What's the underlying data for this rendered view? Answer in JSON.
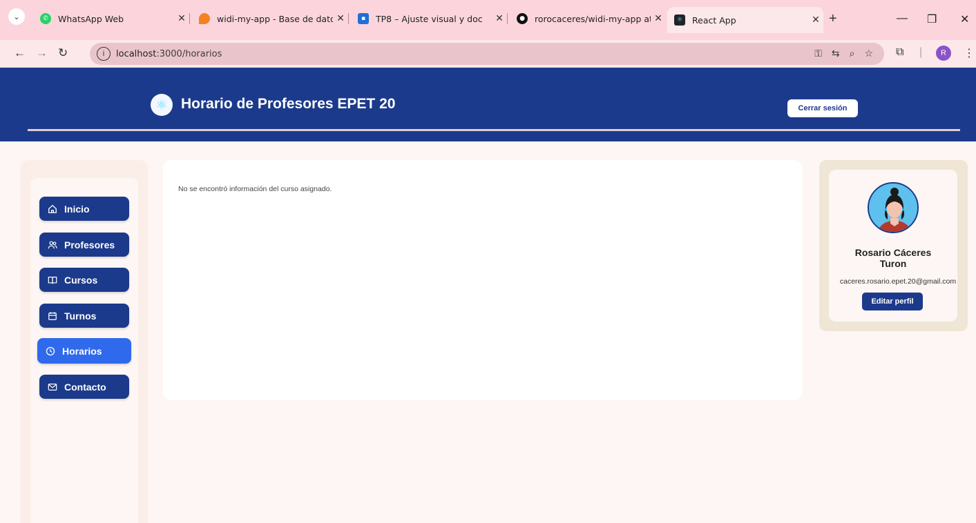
{
  "browser": {
    "tabs": [
      {
        "label": "WhatsApp Web",
        "favicon": "whatsapp-icon",
        "color": "#25d366"
      },
      {
        "label": "widi-my-app - Base de datos",
        "favicon": "firebase-icon",
        "color": "#f58220"
      },
      {
        "label": "TP8 – Ajuste visual y doc",
        "favicon": "classroom-icon",
        "color": "#1e6fd9"
      },
      {
        "label": "rorocaceres/widi-my-app at",
        "favicon": "github-icon",
        "color": "#111111"
      },
      {
        "label": "React App",
        "favicon": "react-icon",
        "color": "#20232a"
      }
    ],
    "new_tab": "+",
    "url_host": "localhost",
    "url_path": ":3000/horarios",
    "profile_initial": "R"
  },
  "header": {
    "title": "Horario de Profesores EPET 20",
    "logout_label": "Cerrar sesión"
  },
  "sidebar": {
    "items": [
      {
        "label": "Inicio",
        "icon": "home-icon",
        "active": false
      },
      {
        "label": "Profesores",
        "icon": "users-icon",
        "active": false
      },
      {
        "label": "Cursos",
        "icon": "book-icon",
        "active": false
      },
      {
        "label": "Turnos",
        "icon": "calendar-icon",
        "active": false
      },
      {
        "label": "Horarios",
        "icon": "clock-icon",
        "active": true
      },
      {
        "label": "Contacto",
        "icon": "mail-icon",
        "active": false
      }
    ]
  },
  "main": {
    "message": "No se encontró información del curso asignado."
  },
  "profile": {
    "name": "Rosario Cáceres Turon",
    "email": "caceres.rosario.epet.20@gmail.com",
    "edit_label": "Editar perfil"
  },
  "colors": {
    "primary": "#1c3a8b",
    "active_nav": "#2f6aec",
    "tabstrip": "#fbd5db"
  }
}
